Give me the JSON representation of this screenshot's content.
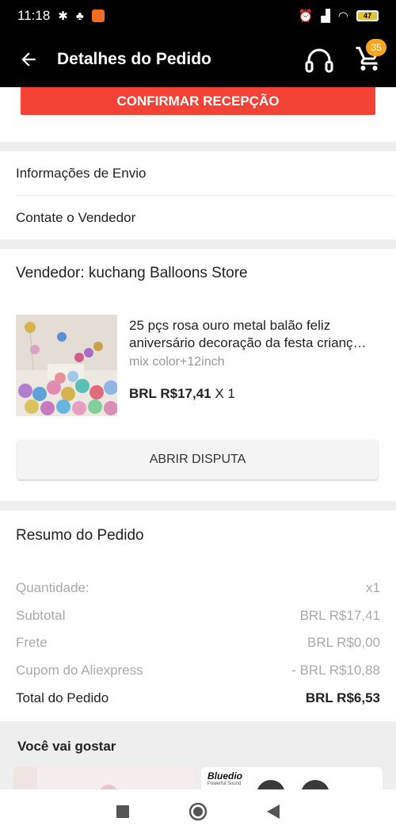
{
  "status_bar": {
    "time": "11:18",
    "battery": "47"
  },
  "app_bar": {
    "title": "Detalhes do Pedido",
    "cart_count": "35"
  },
  "actions": {
    "confirm_label": "CONFIRMAR RECEPÇÃO",
    "dispute_label": "ABRIR DISPUTA"
  },
  "menu": {
    "shipping_info": "Informações de Envio",
    "contact_seller": "Contate o Vendedor"
  },
  "seller": {
    "label": "Vendedor: kuchang Balloons Store"
  },
  "product": {
    "title_line1": "25 pçs rosa ouro metal balão feliz",
    "title_line2": "aniversário decoração da festa crianç…",
    "variant": "mix color+12inch",
    "price": "BRL R$17,41",
    "qty": "X 1"
  },
  "summary": {
    "title": "Resumo do Pedido",
    "rows": [
      {
        "label": "Quantidade:",
        "value": "x1"
      },
      {
        "label": "Subtotal",
        "value": "BRL R$17,41"
      },
      {
        "label": "Frete",
        "value": "BRL R$0,00"
      },
      {
        "label": "Cupom do Aliexpress",
        "value": "- BRL R$10,88"
      }
    ],
    "total": {
      "label": "Total do Pedido",
      "value": "BRL R$6,53"
    }
  },
  "recommendations": {
    "title": "Você vai gostar",
    "brand": "Bluedio",
    "brand_tagline": "Powerful Sound"
  },
  "colors": {
    "accent": "#f44336",
    "badge": "#f5a623",
    "appbar": "#000000"
  }
}
